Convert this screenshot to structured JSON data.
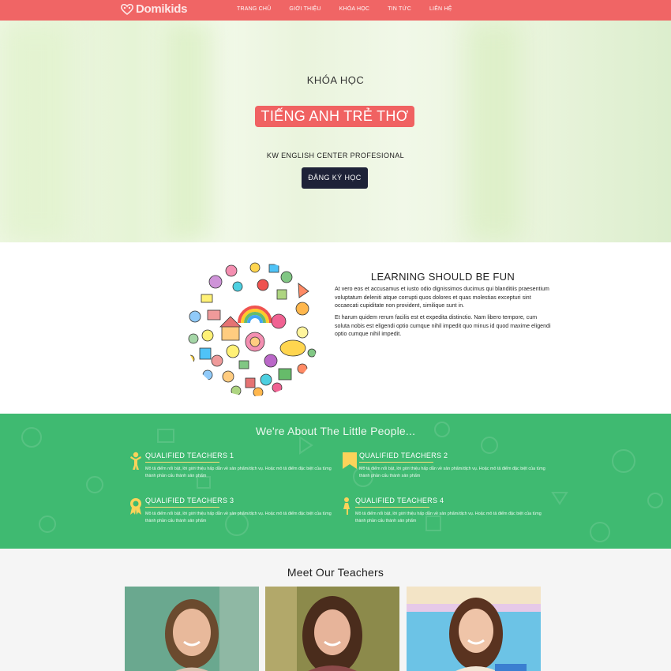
{
  "nav": {
    "logo": "Domikids",
    "items": [
      "TRANG CHỦ",
      "GIỚI THIỆU",
      "KHÓA HỌC",
      "TIN TỨC",
      "LIÊN HỆ"
    ]
  },
  "hero": {
    "subtitle": "KHÓA HỌC",
    "title": "TIẾNG ANH TRẺ THƠ",
    "tagline": "KW ENGLISH CENTER PROFESIONAL",
    "button": "ĐĂNG KÝ HỌC"
  },
  "learning": {
    "title": "LEARNING SHOULD BE FUN",
    "paragraph1": "At vero eos et accusamus et iusto odio dignissimos ducimus qui blanditiis praesentium voluptatum deleniti atque corrupti quos dolores et quas molestias excepturi sint occaecati cupiditate non provident, similique sunt in.",
    "paragraph2": "Et harum quidem rerum facilis est et expedita distinctio. Nam libero tempore, cum soluta nobis est eligendi optio cumque nihil impedit quo minus id quod maxime eligendi optio cumque nihil impedit."
  },
  "about": {
    "title": "We're About The Little People...",
    "features": [
      {
        "title": "QUALIFIED TEACHERS 1",
        "desc": "Mô tả điểm nổi bật, lời giới thiệu hấp dẫn về sản phẩm/dịch vụ. Hoặc mô tả điểm đặc biệt của từng thành phần cấu thành sản phẩm",
        "icon": "child-icon"
      },
      {
        "title": "QUALIFIED TEACHERS 2",
        "desc": "Mô tả điểm nổi bật, lời giới thiệu hấp dẫn về sản phẩm/dịch vụ. Hoặc mô tả điểm đặc biệt của từng thành phần cấu thành sản phẩm",
        "icon": "bookmark-icon"
      },
      {
        "title": "QUALIFIED TEACHERS 3",
        "desc": "Mô tả điểm nổi bật, lời giới thiệu hấp dẫn về sản phẩm/dịch vụ. Hoặc mô tả điểm đặc biệt của từng thành phần cấu thành sản phẩm",
        "icon": "award-icon"
      },
      {
        "title": "QUALIFIED TEACHERS 4",
        "desc": "Mô tả điểm nổi bật, lời giới thiệu hấp dẫn về sản phẩm/dịch vụ. Hoặc mô tả điểm đặc biệt của từng thành phần cấu thành sản phẩm",
        "icon": "girl-icon"
      }
    ]
  },
  "teachers": {
    "title": "Meet Our Teachers"
  },
  "colors": {
    "nav": "#f06565",
    "hero_title_bg": "#f06262",
    "button": "#1e2238",
    "about_bg": "#3fba71",
    "accent_yellow": "#fbe07a"
  }
}
